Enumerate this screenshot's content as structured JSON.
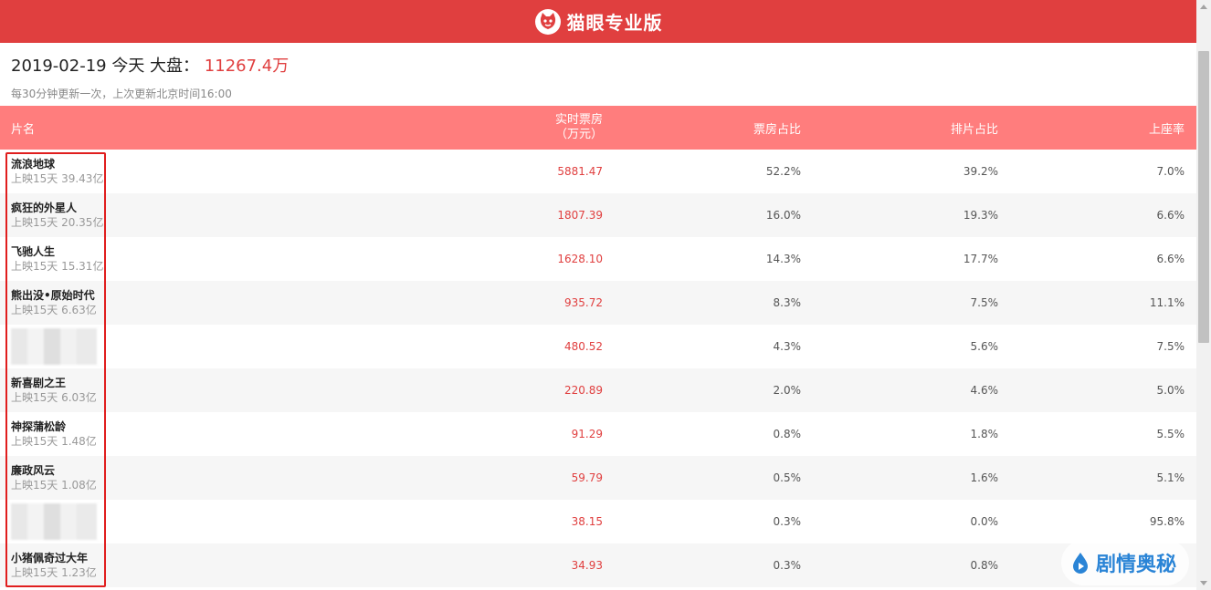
{
  "header": {
    "brand": "猫眼专业版"
  },
  "summary": {
    "date_prefix": "2019-02-19 今天 大盘：",
    "total": "11267.4万",
    "update_note": "每30分钟更新一次，上次更新北京时间16:00"
  },
  "table": {
    "headers": {
      "name": "片名",
      "boxoffice_line1": "实时票房",
      "boxoffice_line2": "（万元）",
      "share": "票房占比",
      "schedule": "排片占比",
      "seat": "上座率"
    },
    "rows": [
      {
        "title": "流浪地球",
        "meta": "上映15天 39.43亿",
        "boxoffice": "5881.47",
        "share": "52.2%",
        "schedule": "39.2%",
        "seat": "7.0%"
      },
      {
        "title": "疯狂的外星人",
        "meta": "上映15天 20.35亿",
        "boxoffice": "1807.39",
        "share": "16.0%",
        "schedule": "19.3%",
        "seat": "6.6%"
      },
      {
        "title": "飞驰人生",
        "meta": "上映15天 15.31亿",
        "boxoffice": "1628.10",
        "share": "14.3%",
        "schedule": "17.7%",
        "seat": "6.6%"
      },
      {
        "title": "熊出没•原始时代",
        "meta": "上映15天 6.63亿",
        "boxoffice": "935.72",
        "share": "8.3%",
        "schedule": "7.5%",
        "seat": "11.1%"
      },
      {
        "title": "",
        "meta": "",
        "boxoffice": "480.52",
        "share": "4.3%",
        "schedule": "5.6%",
        "seat": "7.5%"
      },
      {
        "title": "新喜剧之王",
        "meta": "上映15天 6.03亿",
        "boxoffice": "220.89",
        "share": "2.0%",
        "schedule": "4.6%",
        "seat": "5.0%"
      },
      {
        "title": "神探蒲松龄",
        "meta": "上映15天 1.48亿",
        "boxoffice": "91.29",
        "share": "0.8%",
        "schedule": "1.8%",
        "seat": "5.5%"
      },
      {
        "title": "廉政风云",
        "meta": "上映15天 1.08亿",
        "boxoffice": "59.79",
        "share": "0.5%",
        "schedule": "1.6%",
        "seat": "5.1%"
      },
      {
        "title": "",
        "meta": "",
        "boxoffice": "38.15",
        "share": "0.3%",
        "schedule": "0.0%",
        "seat": "95.8%"
      },
      {
        "title": "小猪佩奇过大年",
        "meta": "上映15天 1.23亿",
        "boxoffice": "34.93",
        "share": "0.3%",
        "schedule": "0.8%",
        "seat": ""
      }
    ]
  },
  "watermark": {
    "text": "剧情奥秘"
  },
  "colors": {
    "brand_red": "#e03f3f",
    "header_pink": "#ff7d7d",
    "highlight": "#e01e1e",
    "watermark_blue": "#2a84d6"
  },
  "icons": {
    "logo": "cat-logo-icon",
    "watermark": "drop-play-icon"
  }
}
